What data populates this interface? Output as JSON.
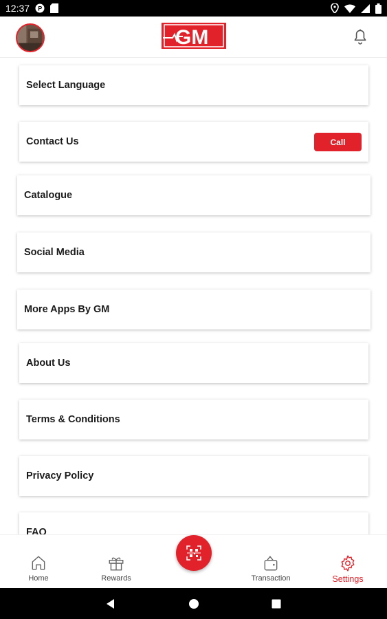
{
  "status_bar": {
    "time": "12:37",
    "left_icons": [
      "parking-icon",
      "sd-card-icon"
    ],
    "right_icons": [
      "location-icon",
      "wifi-icon",
      "signal-icon",
      "battery-icon"
    ]
  },
  "header": {
    "logo_text": "GM",
    "avatar_icon": "user-avatar",
    "bell_icon": "bell-icon"
  },
  "menu": {
    "items": [
      {
        "label": "Select Language"
      },
      {
        "label": "Contact Us",
        "button": "Call"
      },
      {
        "label": "Catalogue"
      },
      {
        "label": "Social Media"
      },
      {
        "label": "More Apps By GM"
      },
      {
        "label": "About Us"
      },
      {
        "label": "Terms & Conditions"
      },
      {
        "label": "Privacy Policy"
      },
      {
        "label": "FAQ"
      }
    ]
  },
  "bottom_nav": {
    "items": [
      {
        "label": "Home",
        "icon": "home-icon"
      },
      {
        "label": "Rewards",
        "icon": "gift-icon"
      },
      {
        "label": "Transaction",
        "icon": "wallet-icon"
      },
      {
        "label": "Settings",
        "icon": "gear-icon",
        "active": true
      }
    ],
    "center_icon": "qr-scan-icon"
  },
  "colors": {
    "brand_red": "#e2222a",
    "text": "#1a1a1a",
    "active_nav": "#e62129"
  }
}
